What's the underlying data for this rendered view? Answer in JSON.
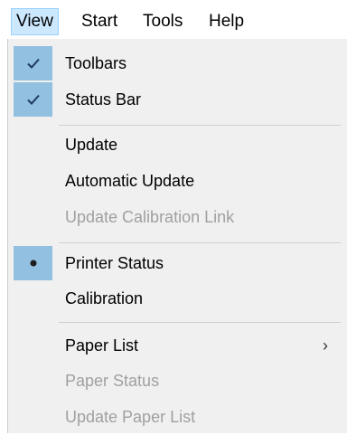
{
  "menubar": {
    "items": [
      {
        "label": "View",
        "active": true
      },
      {
        "label": "Start",
        "active": false
      },
      {
        "label": "Tools",
        "active": false
      },
      {
        "label": "Help",
        "active": false
      }
    ]
  },
  "dropdown": {
    "items": [
      {
        "label": "Toolbars",
        "state": "checkmark",
        "enabled": true
      },
      {
        "label": "Status Bar",
        "state": "checkmark",
        "enabled": true
      },
      {
        "label": "Update",
        "state": "none",
        "enabled": true
      },
      {
        "label": "Automatic Update",
        "state": "none",
        "enabled": true
      },
      {
        "label": "Update Calibration Link",
        "state": "none",
        "enabled": false
      },
      {
        "label": "Printer Status",
        "state": "radio-selected",
        "enabled": true
      },
      {
        "label": "Calibration",
        "state": "none",
        "enabled": true
      },
      {
        "label": "Paper List",
        "state": "none",
        "enabled": true,
        "submenu": true
      },
      {
        "label": "Paper Status",
        "state": "none",
        "enabled": false
      },
      {
        "label": "Update Paper List",
        "state": "none",
        "enabled": false
      }
    ],
    "submenu_arrow": "›"
  },
  "colors": {
    "active_menubar_bg": "#cce8ff",
    "checked_gutter_bg": "#92c0e0",
    "disabled_text": "#a0a0a0",
    "menu_bg": "#f0f0f0"
  }
}
